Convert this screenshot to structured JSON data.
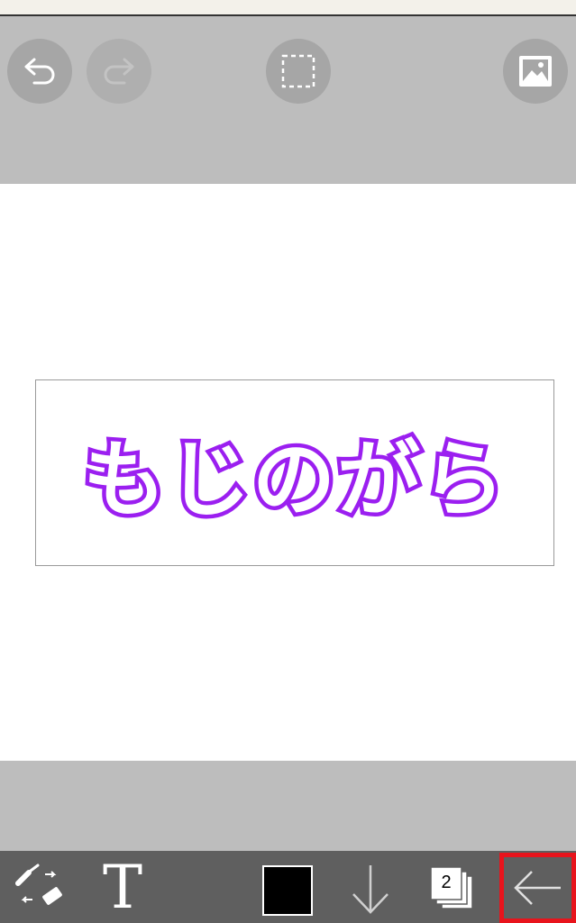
{
  "top_toolbar": {
    "undo_icon": "undo-arrow",
    "redo_icon": "redo-arrow",
    "select_icon": "dashed-selection-square",
    "image_icon": "picture"
  },
  "canvas": {
    "text": "もじのがら",
    "text_color": "#9b1ff0",
    "text_style": "outlined"
  },
  "bottom_toolbar": {
    "brush_eraser_icon": "brush-eraser-swap",
    "text_tool_label": "T",
    "current_color": "#000000",
    "download_icon": "down-arrow",
    "layer_count": "2",
    "back_icon": "left-arrow"
  },
  "highlight_color": "#e8141c"
}
